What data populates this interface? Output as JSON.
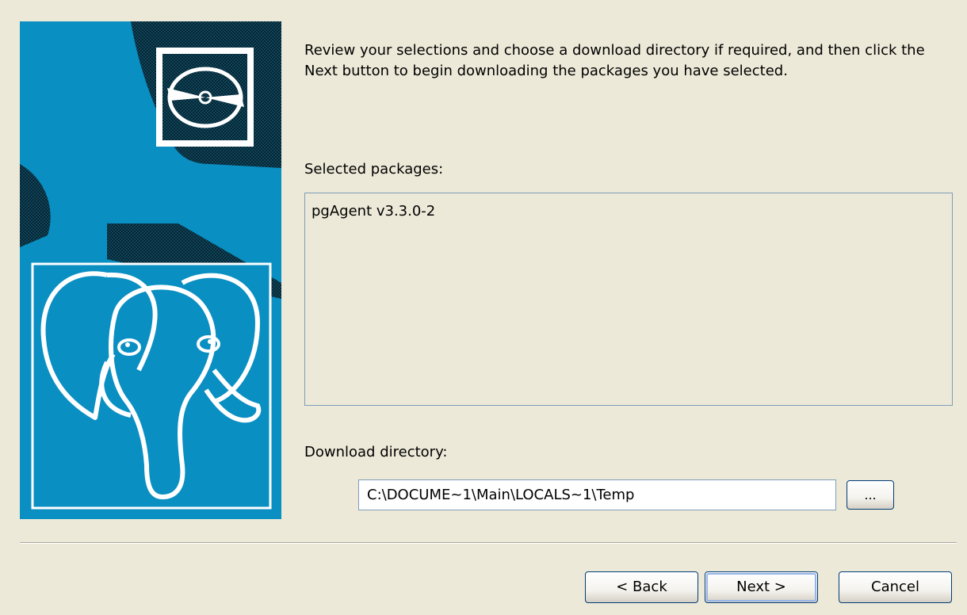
{
  "intro": {
    "text": "Review your selections and choose a download directory if required, and then click the Next button to begin downloading the packages you have selected."
  },
  "packages": {
    "label": "Selected packages:",
    "items": [
      "pgAgent v3.3.0-2"
    ]
  },
  "download": {
    "label": "Download directory:",
    "value": "C:\\DOCUME~1\\Main\\LOCALS~1\\Temp",
    "browse_label": "..."
  },
  "buttons": {
    "back": "< Back",
    "next": "Next >",
    "cancel": "Cancel"
  },
  "colors": {
    "background": "#ECE9D8",
    "banner_blue": "#0A8FC2",
    "banner_dark": "#0D3B4E",
    "default_button_focus": "#97B5E8"
  },
  "banner": {
    "top_icon": "disc-icon",
    "bottom_icon": "postgresql-elephant-logo"
  }
}
